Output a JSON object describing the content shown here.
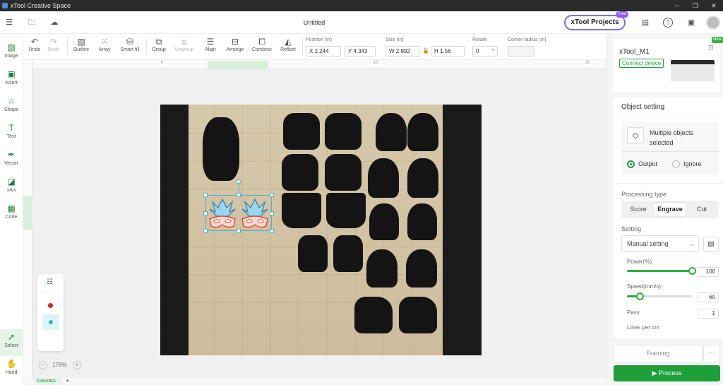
{
  "window": {
    "title": "xTool Creative Space"
  },
  "header": {
    "doc_title": "Untitled",
    "xtool_projects": "xTool Projects",
    "free_badge": "Free"
  },
  "left_tools": [
    {
      "label": "Image"
    },
    {
      "label": "Insert"
    },
    {
      "label": "Shape"
    },
    {
      "label": "Text"
    },
    {
      "label": "Vector"
    },
    {
      "label": "xArt"
    },
    {
      "label": "Code"
    }
  ],
  "bottom_tools": [
    {
      "label": "Select"
    },
    {
      "label": "Hand"
    }
  ],
  "toolbar": {
    "undo": "Undo",
    "redo": "Redo",
    "outline": "Outline",
    "array": "Array",
    "smart_fill": "Smart fill",
    "group": "Group",
    "ungroup": "Ungroup",
    "align": "Align",
    "arrange": "Arrange",
    "combine": "Combine",
    "reflect": "Reflect",
    "position_label": "Position (in)",
    "pos_x": "X 2.244",
    "pos_y": "Y 4.343",
    "size_label": "Size (in)",
    "size_w": "W 2.892",
    "size_h": "H 1.56",
    "rotate_label": "Rotate",
    "rotate_value": "0",
    "rotate_unit": "°",
    "corner_label": "Corner radius (in)",
    "corner_value": ""
  },
  "ruler": {
    "ticks": [
      "0",
      "10",
      "20"
    ]
  },
  "canvas": {
    "zoom": "176%",
    "tab": "Canvas1",
    "add_tab": "+"
  },
  "device": {
    "name": "xTool_M1",
    "connect": "Connect device",
    "new_badge": "New"
  },
  "object_setting": {
    "title": "Object setting",
    "multi_label": "Multiple objects selected",
    "output": "Output",
    "ignore": "Ignore",
    "processing_type_label": "Processing type",
    "types": [
      "Score",
      "Engrave",
      "Cut"
    ],
    "active_type": "Engrave",
    "setting_label": "Setting",
    "setting_value": "Manual setting",
    "power_label": "Power(%)",
    "power_value": "100",
    "power_fraction": 1.0,
    "speed_label": "Speed(mm/s)",
    "speed_value": "60",
    "speed_fraction": 0.2,
    "pass_label": "Pass",
    "pass_value": "1",
    "lines_label": "Lines per cm"
  },
  "actions": {
    "framing": "Framing",
    "more": "···",
    "process": "Process"
  },
  "colors": {
    "accent": "#1f9f3a",
    "layer_red": "#e02020",
    "layer_cyan": "#19b6e6"
  }
}
